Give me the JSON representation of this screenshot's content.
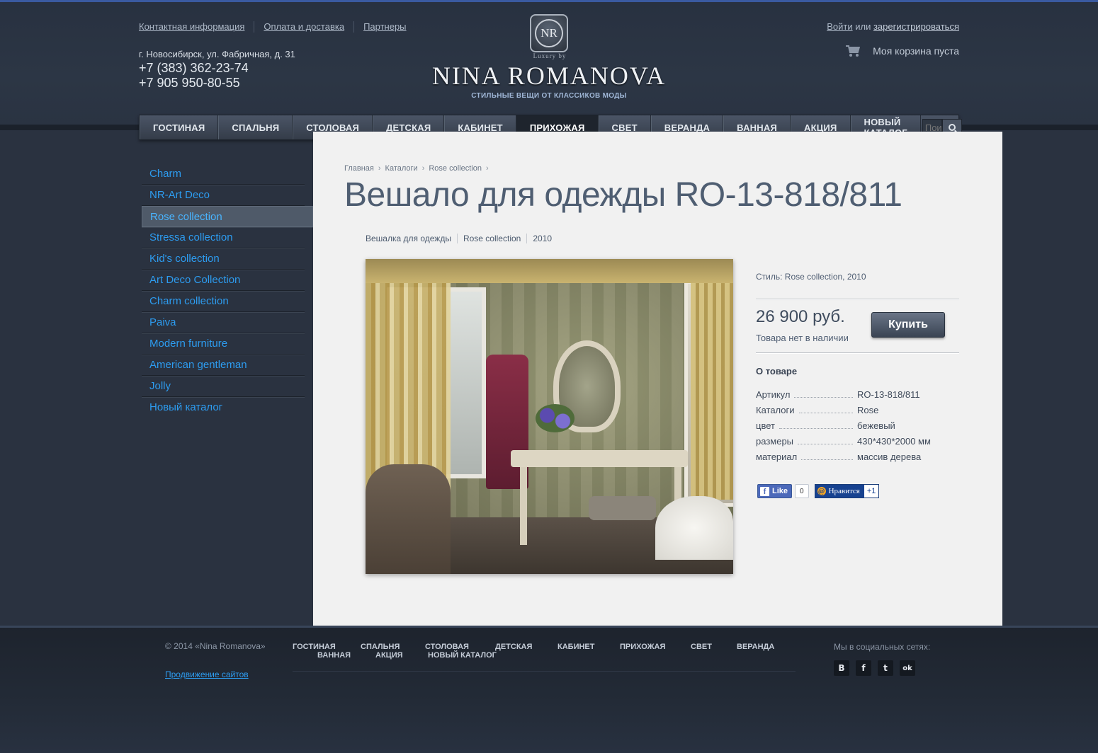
{
  "header": {
    "top_links": [
      "Контактная информация",
      "Оплата и доставка",
      "Партнеры"
    ],
    "address": "г. Новосибирск, ул. Фабричная, д. 31",
    "phone1": "+7 (383) 362-23-74",
    "phone2": "+7 905 950-80-55",
    "logo_mark": "NR",
    "logo_luxury": "Luxury by",
    "logo_name": "NINA ROMANOVA",
    "logo_tagline": "СТИЛЬНЫЕ ВЕЩИ ОТ КЛАССИКОВ МОДЫ",
    "login": "Войти",
    "or": "или",
    "register": "зарегистрироваться",
    "cart_icon": "cart-icon",
    "cart_text": "Моя корзина пуста"
  },
  "nav": {
    "items": [
      "ГОСТИНАЯ",
      "СПАЛЬНЯ",
      "СТОЛОВАЯ",
      "ДЕТСКАЯ",
      "КАБИНЕТ",
      "ПРИХОЖАЯ",
      "СВЕТ",
      "ВЕРАНДА",
      "ВАННАЯ",
      "АКЦИЯ",
      "НОВЫЙ КАТАЛОГ"
    ],
    "active": "ПРИХОЖАЯ",
    "search_placeholder": "Поиск",
    "search_icon": "search-icon"
  },
  "sidebar": {
    "items": [
      "Charm",
      "NR-Art Deco",
      "Rose collection",
      "Stressa collection",
      "Kid's collection",
      "Art Deco Collection",
      "Charm collection",
      "Paiva",
      "Modern furniture",
      "American gentleman",
      "Jolly",
      "Новый каталог"
    ],
    "active": "Rose collection"
  },
  "breadcrumbs": [
    "Главная",
    "Каталоги",
    "Rose collection"
  ],
  "product": {
    "title": "Вешало для одежды RO-13-818/811",
    "tags": [
      "Вешалка для одежды",
      "Rose collection",
      "2010"
    ],
    "style_line": "Стиль: Rose collection, 2010",
    "price": "26 900 руб.",
    "stock": "Товара нет в наличии",
    "buy_label": "Купить",
    "about_heading": "О товаре",
    "props": [
      {
        "k": "Артикул",
        "v": "RO-13-818/811"
      },
      {
        "k": "Каталоги",
        "v": "Rose"
      },
      {
        "k": "цвет",
        "v": "бежевый"
      },
      {
        "k": "размеры",
        "v": "430*430*2000 мм"
      },
      {
        "k": "материал",
        "v": "массив дерева"
      }
    ]
  },
  "social_buttons": {
    "fb_label": "Like",
    "fb_count": "0",
    "mail_label": "Нравится",
    "mail_count": "+1"
  },
  "footer": {
    "copyright": "© 2014 «Nina Romanova»",
    "promo": "Продвижение сайтов",
    "nav_row1": [
      "ГОСТИНАЯ",
      "СПАЛЬНЯ",
      "СТОЛОВАЯ",
      "ДЕТСКАЯ",
      "КАБИНЕТ",
      "ПРИХОЖАЯ",
      "СВЕТ",
      "ВЕРАНДА"
    ],
    "nav_row2": [
      "ВАННАЯ",
      "АКЦИЯ",
      "НОВЫЙ КАТАЛОГ"
    ],
    "social_heading": "Мы в социальных сетях:",
    "social_icons": [
      "В",
      "f",
      "t",
      "ok"
    ]
  },
  "colors": {
    "background": "#2a3240",
    "link": "#2d9cf0",
    "content_bg": "#f1f1f1",
    "title": "#4f5e72"
  }
}
